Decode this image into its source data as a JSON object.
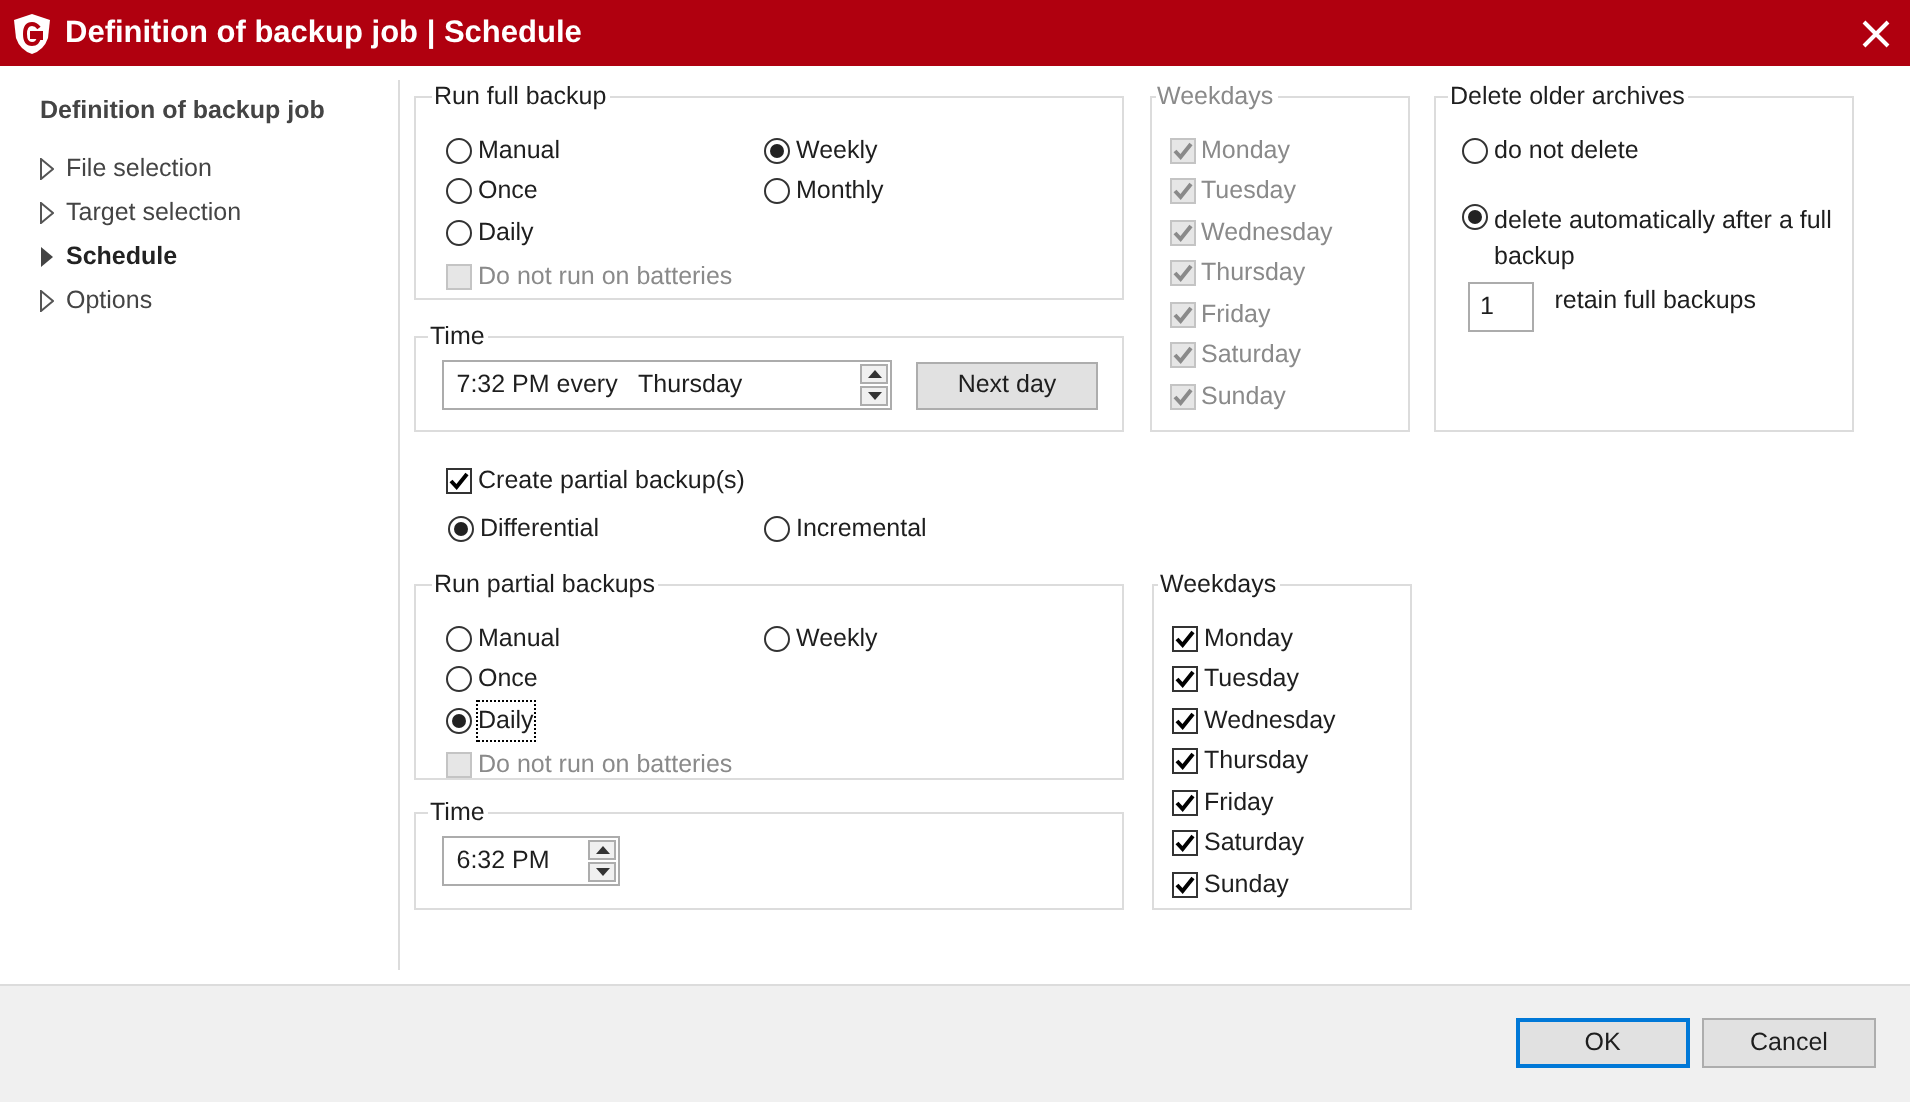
{
  "window": {
    "title": "Definition of backup job | Schedule"
  },
  "sidebar": {
    "heading": "Definition of backup job",
    "items": [
      {
        "label": "File selection",
        "selected": false
      },
      {
        "label": "Target selection",
        "selected": false
      },
      {
        "label": "Schedule",
        "selected": true
      },
      {
        "label": "Options",
        "selected": false
      }
    ]
  },
  "full_backup": {
    "title": "Run full backup",
    "options": [
      {
        "label": "Manual",
        "selected": false
      },
      {
        "label": "Once",
        "selected": false
      },
      {
        "label": "Daily",
        "selected": false
      },
      {
        "label": "Weekly",
        "selected": true
      },
      {
        "label": "Monthly",
        "selected": false
      }
    ],
    "batteries": {
      "label": "Do not run on batteries",
      "checked": false,
      "disabled": true
    }
  },
  "full_time": {
    "title": "Time",
    "value": "7:32 PM every   Thursday",
    "button": "Next day"
  },
  "full_weekdays": {
    "title": "Weekdays",
    "disabled": true,
    "days": [
      {
        "label": "Monday",
        "checked": true
      },
      {
        "label": "Tuesday",
        "checked": true
      },
      {
        "label": "Wednesday",
        "checked": true
      },
      {
        "label": "Thursday",
        "checked": true
      },
      {
        "label": "Friday",
        "checked": true
      },
      {
        "label": "Saturday",
        "checked": true
      },
      {
        "label": "Sunday",
        "checked": true
      }
    ]
  },
  "delete_archives": {
    "title": "Delete older archives",
    "options": [
      {
        "label": "do not delete",
        "selected": false
      },
      {
        "label": "delete automatically after a full backup",
        "selected": true
      }
    ],
    "retain_value": "1",
    "retain_label": "retain full backups"
  },
  "partial": {
    "label": "Create partial backup(s)",
    "checked": true,
    "types": [
      {
        "label": "Differential",
        "selected": true
      },
      {
        "label": "Incremental",
        "selected": false
      }
    ]
  },
  "partial_backups": {
    "title": "Run partial backups",
    "options": [
      {
        "label": "Manual",
        "selected": false,
        "focused": false
      },
      {
        "label": "Once",
        "selected": false,
        "focused": false
      },
      {
        "label": "Daily",
        "selected": true,
        "focused": true
      },
      {
        "label": "Weekly",
        "selected": false,
        "focused": false
      }
    ],
    "batteries": {
      "label": "Do not run on batteries",
      "checked": false,
      "disabled": true
    }
  },
  "partial_time": {
    "title": "Time",
    "value": "6:32 PM"
  },
  "partial_weekdays": {
    "title": "Weekdays",
    "disabled": false,
    "days": [
      {
        "label": "Monday",
        "checked": true
      },
      {
        "label": "Tuesday",
        "checked": true
      },
      {
        "label": "Wednesday",
        "checked": true
      },
      {
        "label": "Thursday",
        "checked": true
      },
      {
        "label": "Friday",
        "checked": true
      },
      {
        "label": "Saturday",
        "checked": true
      },
      {
        "label": "Sunday",
        "checked": true
      }
    ]
  },
  "buttons": [
    {
      "label": "OK",
      "default": true
    },
    {
      "label": "Cancel",
      "default": false
    }
  ]
}
